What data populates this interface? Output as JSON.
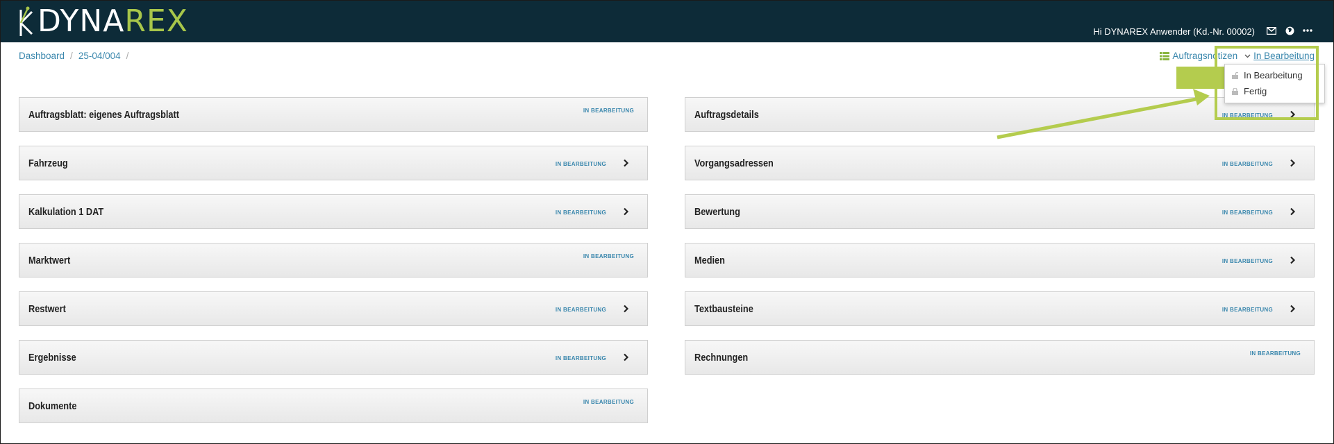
{
  "header": {
    "logo_part1": "DYNA",
    "logo_part2": "REX",
    "user_greeting": "Hi DYNAREX Anwender (Kd.-Nr. 00002)",
    "icons": [
      "mail-icon",
      "globe-icon",
      "more-icon"
    ]
  },
  "breadcrumb": {
    "items": [
      "Dashboard",
      "25-04/004"
    ],
    "separator": "/"
  },
  "toolbar": {
    "notes_label": "Auftragsnotizen",
    "status_label": "In Bearbeitung"
  },
  "status_dropdown": {
    "options": [
      "In Bearbeitung",
      "Fertig"
    ]
  },
  "panels_left": [
    {
      "title": "Auftragsblatt: eigenes Auftragsblatt",
      "status": "IN BEARBEITUNG",
      "has_arrow": false
    },
    {
      "title": "Fahrzeug",
      "status": "IN BEARBEITUNG",
      "has_arrow": true
    },
    {
      "title": "Kalkulation 1 DAT",
      "status": "IN BEARBEITUNG",
      "has_arrow": true
    },
    {
      "title": "Marktwert",
      "status": "IN BEARBEITUNG",
      "has_arrow": false
    },
    {
      "title": "Restwert",
      "status": "IN BEARBEITUNG",
      "has_arrow": true
    },
    {
      "title": "Ergebnisse",
      "status": "IN BEARBEITUNG",
      "has_arrow": true
    },
    {
      "title": "Dokumente",
      "status": "IN BEARBEITUNG",
      "has_arrow": false
    }
  ],
  "panels_right": [
    {
      "title": "Auftragsdetails",
      "status": "IN BEARBEITUNG",
      "has_arrow": true
    },
    {
      "title": "Vorgangsadressen",
      "status": "IN BEARBEITUNG",
      "has_arrow": true
    },
    {
      "title": "Bewertung",
      "status": "IN BEARBEITUNG",
      "has_arrow": true
    },
    {
      "title": "Medien",
      "status": "IN BEARBEITUNG",
      "has_arrow": true
    },
    {
      "title": "Textbausteine",
      "status": "IN BEARBEITUNG",
      "has_arrow": true
    },
    {
      "title": "Rechnungen",
      "status": "IN BEARBEITUNG",
      "has_arrow": false
    }
  ],
  "colors": {
    "header_bg": "#0d2b38",
    "brand_green": "#a8c64a",
    "highlight_green": "#b4cc4e",
    "link_blue": "#3a87ad"
  }
}
